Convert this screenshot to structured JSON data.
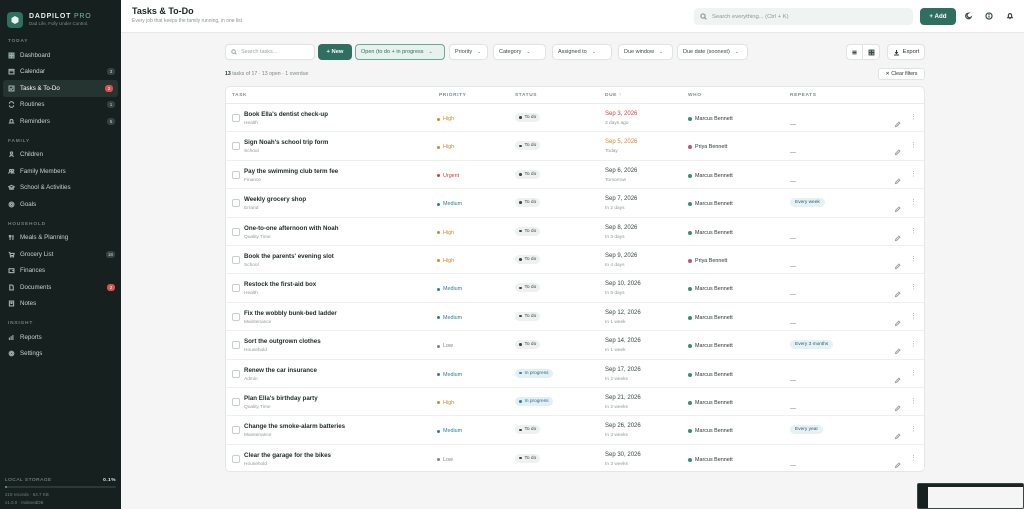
{
  "brand": {
    "name": "DADPILOT",
    "suffix": "PRO",
    "tagline": "Dad Life, Fully Under Control."
  },
  "sidebar": {
    "sections": [
      {
        "label": "TODAY",
        "items": [
          {
            "label": "Dashboard",
            "icon": "grid-icon",
            "badge": ""
          },
          {
            "label": "Calendar",
            "icon": "calendar-icon",
            "badge": "3"
          },
          {
            "label": "Tasks & To-Do",
            "icon": "checklist-icon",
            "badge": "2",
            "active": true,
            "badge_red": true
          },
          {
            "label": "Routines",
            "icon": "repeat-icon",
            "badge": "1"
          },
          {
            "label": "Reminders",
            "icon": "bell-icon",
            "badge": "5"
          }
        ]
      },
      {
        "label": "FAMILY",
        "items": [
          {
            "label": "Children",
            "icon": "child-icon",
            "badge": ""
          },
          {
            "label": "Family Members",
            "icon": "users-icon",
            "badge": ""
          },
          {
            "label": "School & Activities",
            "icon": "school-icon",
            "badge": ""
          },
          {
            "label": "Goals",
            "icon": "target-icon",
            "badge": ""
          }
        ]
      },
      {
        "label": "HOUSEHOLD",
        "items": [
          {
            "label": "Meals & Planning",
            "icon": "meal-icon",
            "badge": ""
          },
          {
            "label": "Grocery List",
            "icon": "cart-icon",
            "badge": "18"
          },
          {
            "label": "Finances",
            "icon": "wallet-icon",
            "badge": ""
          },
          {
            "label": "Documents",
            "icon": "document-icon",
            "badge": "2",
            "badge_red": true
          },
          {
            "label": "Notes",
            "icon": "note-icon",
            "badge": ""
          }
        ]
      },
      {
        "label": "INSIGHT",
        "items": [
          {
            "label": "Reports",
            "icon": "chart-icon",
            "badge": ""
          },
          {
            "label": "Settings",
            "icon": "gear-icon",
            "badge": ""
          }
        ]
      }
    ],
    "storage": {
      "label": "LOCAL STORAGE",
      "percent": "0.1%",
      "records": "219 records · 64.7 KB",
      "version": "v1.0.0 · IndexedDB"
    }
  },
  "header": {
    "title": "Tasks & To-Do",
    "subtitle": "Every job that keeps the family running, in one list",
    "search_placeholder": "Search everything... (Ctrl + K)",
    "add_label": "+ Add"
  },
  "toolbar": {
    "search_placeholder": "Search tasks...",
    "new_label": "+ New",
    "filters": [
      {
        "label": "Open (to do + in progress",
        "active": true
      },
      {
        "label": "Priority"
      },
      {
        "label": "Category"
      },
      {
        "label": "Assigned to"
      },
      {
        "label": "Due window"
      },
      {
        "label": "Due date (soonest)"
      }
    ],
    "export_label": "Export"
  },
  "summary": {
    "count": "13",
    "text": " tasks of 17 · 13 open · 1 overdue"
  },
  "clear_filters": "✕  Clear filters",
  "table": {
    "headers": {
      "task": "TASK",
      "priority": "PRIORITY",
      "status": "STATUS",
      "due": "DUE ↑",
      "who": "WHO",
      "repeats": "REPEATS"
    },
    "rows": [
      {
        "title": "Book Ella's dentist check-up",
        "category": "Health",
        "priority": "High",
        "status": "To do",
        "due": "Sep 3, 2026",
        "due_rel": "3 days ago",
        "due_state": "overdue",
        "who": "Marcus Bennett",
        "who_color": "#3b8f6e",
        "repeats": "—"
      },
      {
        "title": "Sign Noah's school trip form",
        "category": "School",
        "priority": "High",
        "status": "To do",
        "due": "Sep 5, 2026",
        "due_rel": "Today",
        "due_state": "today",
        "who": "Priya Bennett",
        "who_color": "#c2556d",
        "repeats": "—"
      },
      {
        "title": "Pay the swimming club term fee",
        "category": "Finance",
        "priority": "Urgent",
        "status": "To do",
        "due": "Sep 6, 2026",
        "due_rel": "Tomorrow",
        "due_state": "normal",
        "who": "Marcus Bennett",
        "who_color": "#3b8f6e",
        "repeats": "—"
      },
      {
        "title": "Weekly grocery shop",
        "category": "Errand",
        "priority": "Medium",
        "status": "To do",
        "due": "Sep 7, 2026",
        "due_rel": "In 2 days",
        "due_state": "normal",
        "who": "Marcus Bennett",
        "who_color": "#3b8f6e",
        "repeats": "Every week"
      },
      {
        "title": "One-to-one afternoon with Noah",
        "category": "Quality Time",
        "priority": "High",
        "status": "To do",
        "due": "Sep 8, 2026",
        "due_rel": "In 3 days",
        "due_state": "normal",
        "who": "Marcus Bennett",
        "who_color": "#3b8f6e",
        "repeats": "—"
      },
      {
        "title": "Book the parents' evening slot",
        "category": "School",
        "priority": "High",
        "status": "To do",
        "due": "Sep 9, 2026",
        "due_rel": "In 4 days",
        "due_state": "normal",
        "who": "Priya Bennett",
        "who_color": "#c2556d",
        "repeats": "—"
      },
      {
        "title": "Restock the first-aid box",
        "category": "Health",
        "priority": "Medium",
        "status": "To do",
        "due": "Sep 10, 2026",
        "due_rel": "In 5 days",
        "due_state": "normal",
        "who": "Marcus Bennett",
        "who_color": "#3b8f6e",
        "repeats": "—"
      },
      {
        "title": "Fix the wobbly bunk-bed ladder",
        "category": "Maintenance",
        "priority": "Medium",
        "status": "To do",
        "due": "Sep 12, 2026",
        "due_rel": "In 1 week",
        "due_state": "normal",
        "who": "Marcus Bennett",
        "who_color": "#3b8f6e",
        "repeats": "—"
      },
      {
        "title": "Sort the outgrown clothes",
        "category": "Household",
        "priority": "Low",
        "status": "To do",
        "due": "Sep 14, 2026",
        "due_rel": "In 1 week",
        "due_state": "normal",
        "who": "Marcus Bennett",
        "who_color": "#3b8f6e",
        "repeats": "Every 3 months"
      },
      {
        "title": "Renew the car insurance",
        "category": "Admin",
        "priority": "Medium",
        "status": "In progress",
        "due": "Sep 17, 2026",
        "due_rel": "In 2 weeks",
        "due_state": "normal",
        "who": "Marcus Bennett",
        "who_color": "#3b8f6e",
        "repeats": "—"
      },
      {
        "title": "Plan Ella's birthday party",
        "category": "Quality Time",
        "priority": "High",
        "status": "In progress",
        "due": "Sep 21, 2026",
        "due_rel": "In 2 weeks",
        "due_state": "normal",
        "who": "Marcus Bennett",
        "who_color": "#3b8f6e",
        "repeats": "—"
      },
      {
        "title": "Change the smoke-alarm batteries",
        "category": "Maintenance",
        "priority": "Medium",
        "status": "To do",
        "due": "Sep 26, 2026",
        "due_rel": "In 3 weeks",
        "due_state": "normal",
        "who": "Marcus Bennett",
        "who_color": "#3b8f6e",
        "repeats": "Every year"
      },
      {
        "title": "Clear the garage for the bikes",
        "category": "Household",
        "priority": "Low",
        "status": "To do",
        "due": "Sep 30, 2026",
        "due_rel": "In 3 weeks",
        "due_state": "normal",
        "who": "Marcus Bennett",
        "who_color": "#3b8f6e",
        "repeats": "—"
      }
    ]
  },
  "colors": {
    "accent": "#2f6f60",
    "priority": {
      "High": "#d08a2a",
      "Urgent": "#c9423e",
      "Medium": "#2e7d9a",
      "Low": "#7b8683"
    },
    "due": {
      "overdue": "#d0433f",
      "today": "#c98a26",
      "normal": "#3a4644"
    }
  }
}
